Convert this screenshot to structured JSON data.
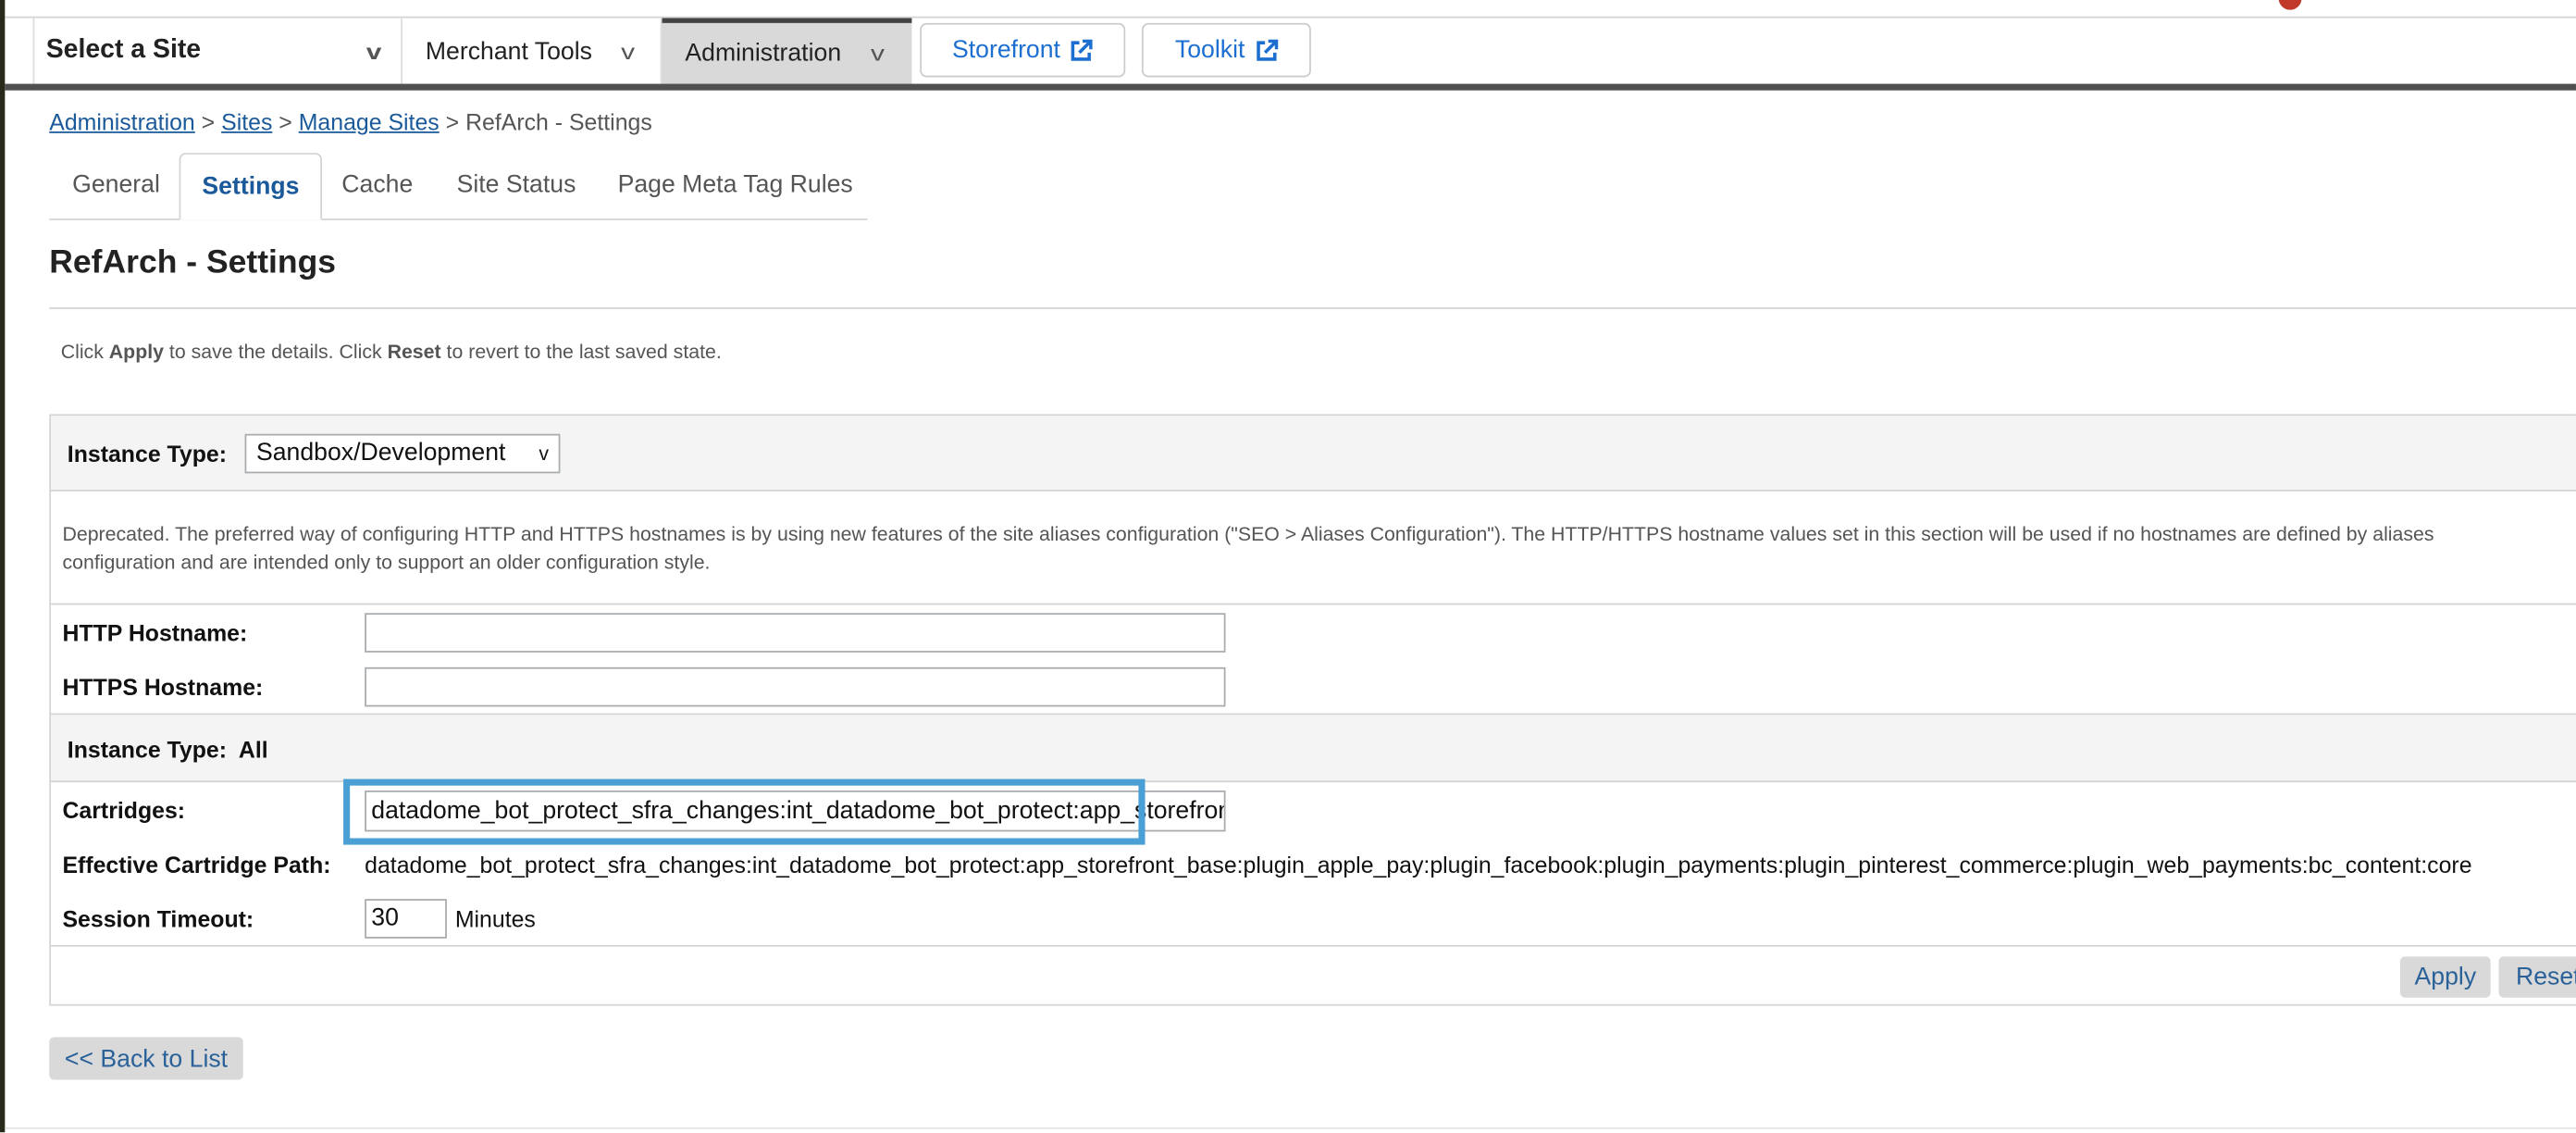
{
  "nav": {
    "site_select": "Select a Site",
    "merchant_tools": "Merchant Tools",
    "administration": "Administration",
    "storefront": "Storefront",
    "toolkit": "Toolkit"
  },
  "breadcrumb": {
    "items": [
      "Administration",
      "Sites",
      "Manage Sites"
    ],
    "current": "RefArch - Settings",
    "separator": ">"
  },
  "tabs": [
    "General",
    "Settings",
    "Cache",
    "Site Status",
    "Page Meta Tag Rules"
  ],
  "active_tab": "Settings",
  "page_title": "RefArch - Settings",
  "instructions": {
    "p1": "Click ",
    "apply": "Apply",
    "p2": " to save the details. Click ",
    "reset": "Reset",
    "p3": " to revert to the last saved state."
  },
  "form": {
    "instance_type_label": "Instance Type:",
    "instance_type_value": "Sandbox/Development",
    "deprecated_note": "Deprecated. The preferred way of configuring HTTP and HTTPS hostnames is by using new features of the site aliases configuration (\"SEO > Aliases Configuration\"). The HTTP/HTTPS hostname values set in this section will be used if no hostnames are defined by aliases configuration and are intended only to support an older configuration style.",
    "http_label": "HTTP Hostname:",
    "http_value": "",
    "https_label": "HTTPS Hostname:",
    "https_value": "",
    "instance_all_label": "Instance Type:",
    "instance_all_value": "All",
    "cartridges_label": "Cartridges:",
    "cartridges_value": "datadome_bot_protect_sfra_changes:int_datadome_bot_protect:app_storefront_base",
    "effective_label": "Effective Cartridge Path:",
    "effective_value": "datadome_bot_protect_sfra_changes:int_datadome_bot_protect:app_storefront_base:plugin_apple_pay:plugin_facebook:plugin_payments:plugin_pinterest_commerce:plugin_web_payments:bc_content:core",
    "session_label": "Session Timeout:",
    "session_value": "30",
    "session_unit": "Minutes"
  },
  "buttons": {
    "apply": "Apply",
    "reset": "Reset",
    "back": "<< Back to List"
  },
  "colors": {
    "link": "#1b5a9a",
    "highlight": "#4a9fd5",
    "navbar": "#505050"
  }
}
